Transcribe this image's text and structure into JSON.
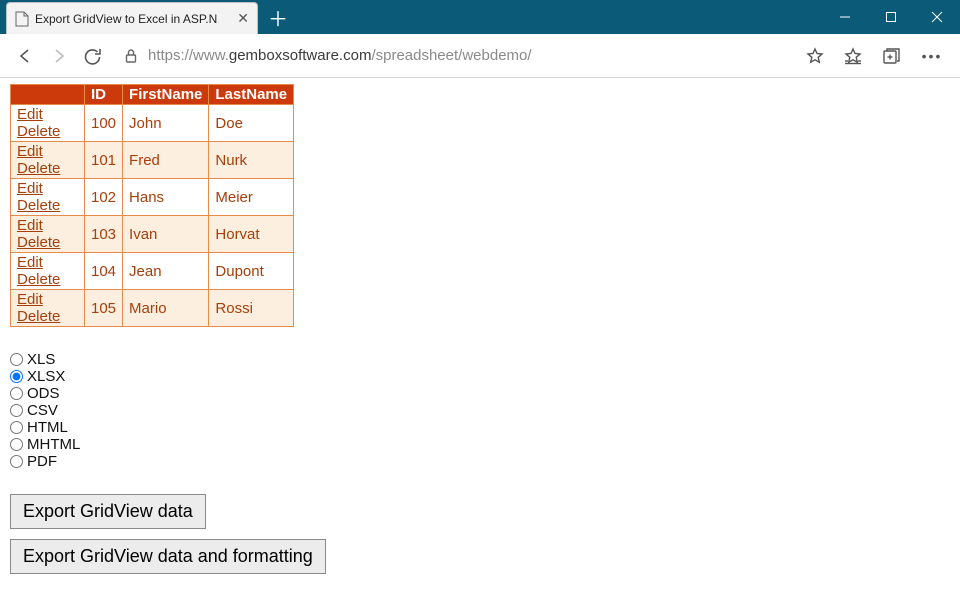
{
  "window": {
    "tab_title": "Export GridView to Excel in ASP.N"
  },
  "url": {
    "scheme": "https://",
    "prefix": "www.",
    "host": "gemboxsoftware.com",
    "path": "/spreadsheet/webdemo/"
  },
  "grid": {
    "edit_label": "Edit",
    "delete_label": "Delete",
    "headers": {
      "blank": "",
      "id": "ID",
      "first": "FirstName",
      "last": "LastName"
    },
    "rows": [
      {
        "id": "100",
        "first": "John",
        "last": "Doe"
      },
      {
        "id": "101",
        "first": "Fred",
        "last": "Nurk"
      },
      {
        "id": "102",
        "first": "Hans",
        "last": "Meier"
      },
      {
        "id": "103",
        "first": "Ivan",
        "last": "Horvat"
      },
      {
        "id": "104",
        "first": "Jean",
        "last": "Dupont"
      },
      {
        "id": "105",
        "first": "Mario",
        "last": "Rossi"
      }
    ]
  },
  "formats": {
    "options": [
      "XLS",
      "XLSX",
      "ODS",
      "CSV",
      "HTML",
      "MHTML",
      "PDF"
    ],
    "selected": "XLSX"
  },
  "buttons": {
    "export_data": "Export GridView data",
    "export_data_fmt": "Export GridView data and formatting"
  }
}
